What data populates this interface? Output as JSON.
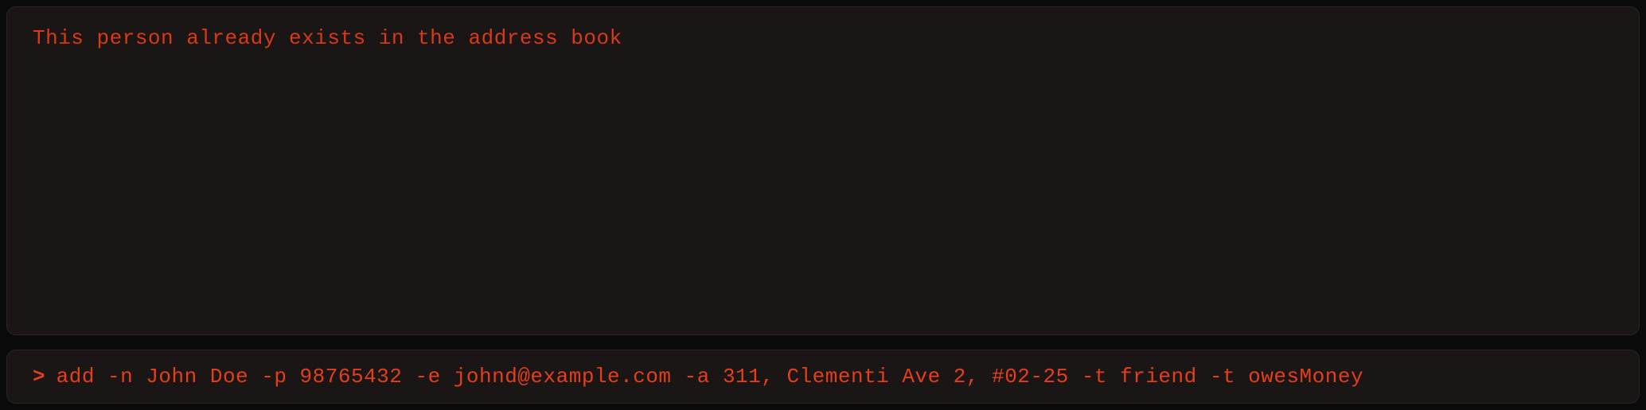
{
  "output": {
    "message": "This person already exists in the address book"
  },
  "input": {
    "prompt_symbol": ">",
    "command_value": "add -n John Doe -p 98765432 -e johnd@example.com -a 311, Clementi Ave 2, #02-25 -t friend -t owesMoney",
    "placeholder": ""
  }
}
